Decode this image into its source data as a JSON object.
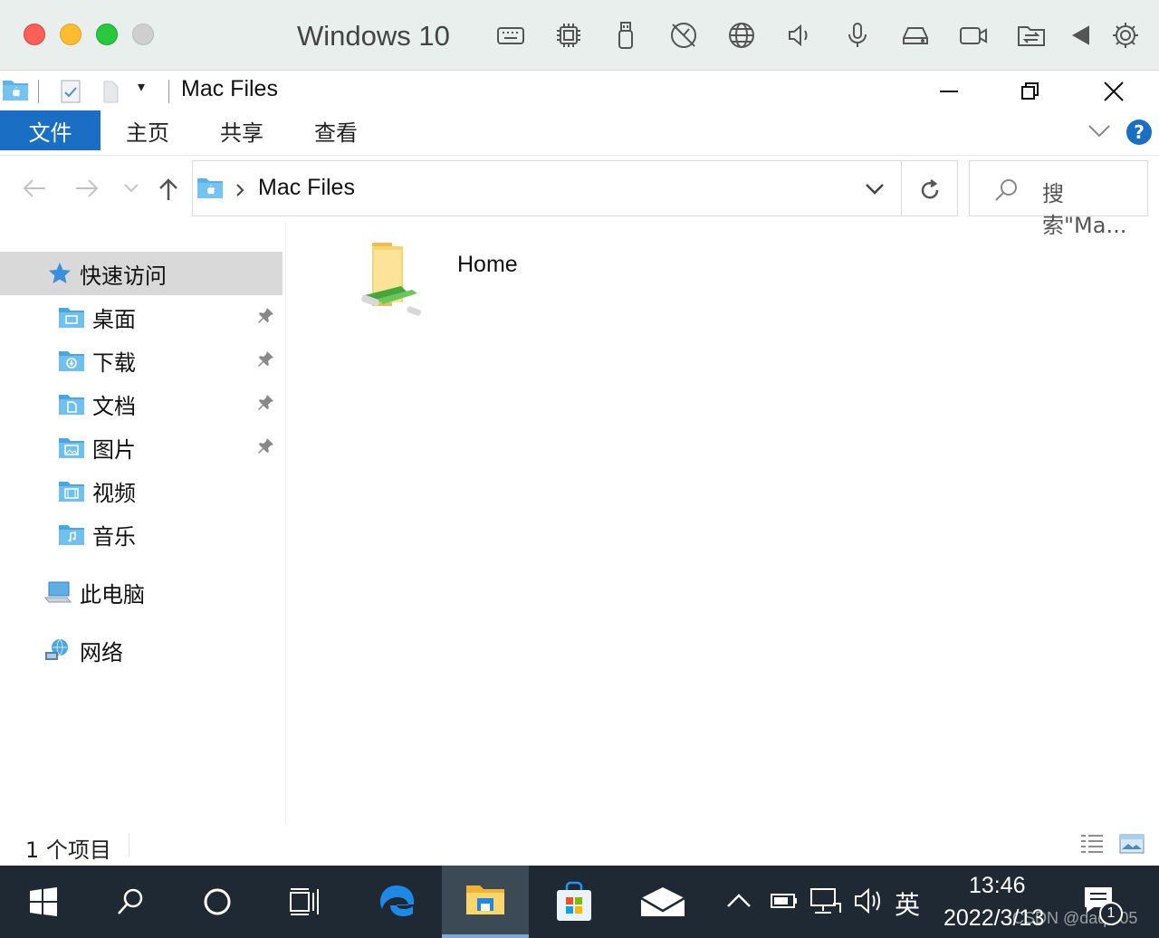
{
  "vm": {
    "title": "Windows 10",
    "toolbar_icons": [
      "keyboard-icon",
      "cpu-icon",
      "usb-icon",
      "gauge-icon",
      "globe-icon",
      "speaker-icon",
      "microphone-icon",
      "drive-icon",
      "camera-icon",
      "share-folder-icon",
      "back-triangle-icon",
      "settings-icon"
    ]
  },
  "window": {
    "title": "Mac Files"
  },
  "ribbon": {
    "tabs": [
      "文件",
      "主页",
      "共享",
      "查看"
    ],
    "help": "?"
  },
  "address": {
    "path": "Mac Files",
    "search_placeholder": "搜索\"Ma..."
  },
  "sidebar": {
    "quick_access": "快速访问",
    "items": [
      {
        "label": "桌面",
        "pinned": true
      },
      {
        "label": "下载",
        "pinned": true
      },
      {
        "label": "文档",
        "pinned": true
      },
      {
        "label": "图片",
        "pinned": true
      },
      {
        "label": "视频",
        "pinned": false
      },
      {
        "label": "音乐",
        "pinned": false
      }
    ],
    "this_pc": "此电脑",
    "network": "网络"
  },
  "content": {
    "items": [
      {
        "label": "Home"
      }
    ]
  },
  "status": {
    "count": "1 个项目"
  },
  "taskbar": {
    "ime": "英",
    "time": "13:46",
    "date": "2022/3/13",
    "notification_count": "1",
    "watermark": "CSDN @daqi205"
  },
  "colors": {
    "accent": "#1a6fc4",
    "taskbar": "#1e2933",
    "folder": "#5ab3e8",
    "close": "#fe5f57",
    "minimize": "#febc2e",
    "maximize": "#28c840"
  }
}
